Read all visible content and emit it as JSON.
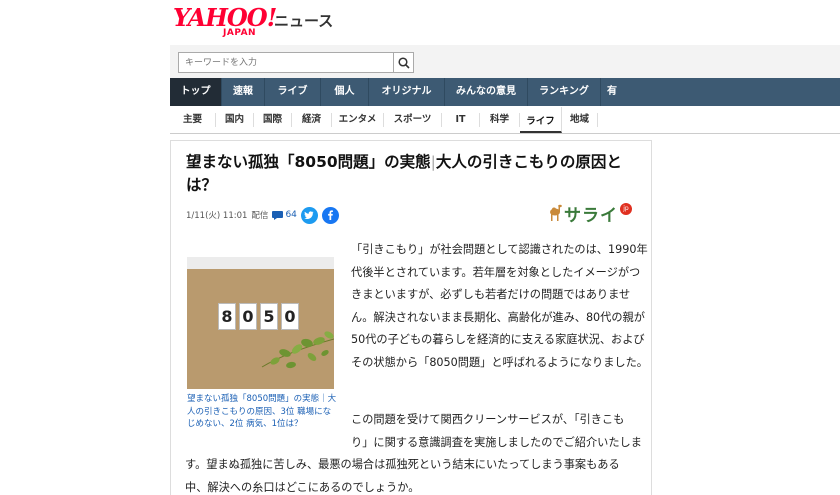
{
  "header": {
    "logo_main": "YAHOO!",
    "logo_sub": "JAPAN",
    "service_name": "ニュース"
  },
  "search": {
    "placeholder": "キーワードを入力"
  },
  "main_nav": [
    "トップ",
    "速報",
    "ライブ",
    "個人",
    "オリジナル",
    "みんなの意見",
    "ランキング",
    "有"
  ],
  "main_nav_active": "トップ",
  "sub_nav": [
    "主要",
    "国内",
    "国際",
    "経済",
    "エンタメ",
    "スポーツ",
    "IT",
    "科学",
    "ライフ",
    "地域"
  ],
  "sub_nav_active": "ライフ",
  "article": {
    "title_part1": "望まない孤独「8050問題」の実態",
    "title_sep": "|",
    "title_part2": "大人の引きこもりの原因とは？",
    "date": "1/11(火) 11:01",
    "delivery": "配信",
    "comment_count": "64",
    "publisher": "サライ",
    "publisher_badge": "jp",
    "photo_digits": [
      "8",
      "0",
      "5",
      "0"
    ],
    "photo_caption": "望まない孤独「8050問題」の実態｜大人の引きこもりの原因、3位 職場になじめない、2位 病気、1位は？",
    "paragraph1": "「引きこもり」が社会問題として認識されたのは、1990年代後半とされています。若年層を対象としたイメージがつきまといますが、必ずしも若者だけの問題ではありません。解決されないまま長期化、高齢化が進み、80代の親が50代の子どもの暮らしを経済的に支える家庭状況、およびその状態から「8050問題」と呼ばれるようになりました。",
    "paragraph2_line1": "この問題を受けて関西クリーンサービスが、「引きこも",
    "paragraph2_line2": "り」に関する意識調査を実施しましたのでご紹介いたしま",
    "paragraph2_line3": "す。望まぬ孤独に苦しみ、最悪の場合は孤独死という結末にいたってしまう事案もある",
    "paragraph2_line4": "中、解決への糸口はどこにあるのでしょうか。"
  },
  "colors": {
    "logo_red": "#ff0033",
    "nav_bg": "#3d5a73",
    "nav_active_bg": "#222c36",
    "link_blue": "#1a5fb4"
  }
}
